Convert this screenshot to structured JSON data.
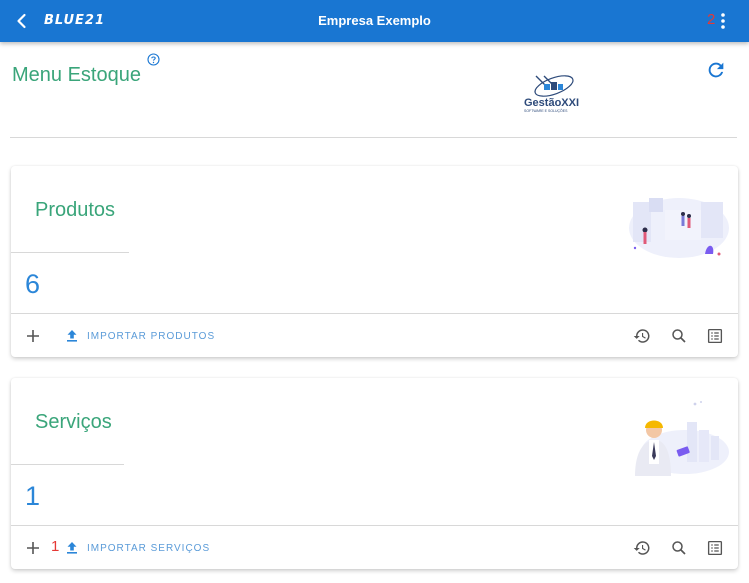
{
  "topbar": {
    "brand": "BLUE21",
    "company": "Empresa Exemplo",
    "badge": "2",
    "icons": [
      "chevron-left-icon",
      "kebab-menu-icon"
    ]
  },
  "header": {
    "title": "Menu Estoque",
    "logo_text": "GestãoXXI",
    "logo_tagline": "SOFTWARE E SOLUÇÕES",
    "icons": [
      "help-circle-icon",
      "refresh-icon"
    ]
  },
  "cards": [
    {
      "title": "Produtos",
      "count": "6",
      "import_label": "IMPORTAR PRODUTOS",
      "badge": ""
    },
    {
      "title": "Serviços",
      "count": "1",
      "import_label": "IMPORTAR SERVIÇOS",
      "badge": "1"
    }
  ],
  "colors": {
    "topbar": "#1976d2",
    "title_green": "#3aa57a",
    "count_blue": "#2b86d8",
    "badge_red": "#e53935"
  }
}
